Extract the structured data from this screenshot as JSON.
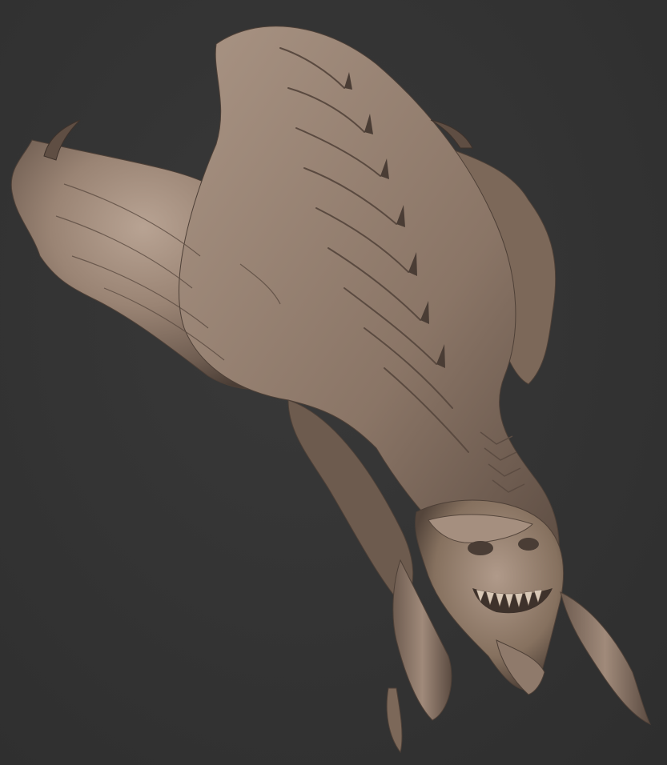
{
  "scene": {
    "subject": "creature-head-sculpt",
    "colors": {
      "background": "#323232",
      "clay_base": "#8f7a6b",
      "clay_light": "#b8a393",
      "clay_shadow": "#5a4a40",
      "clay_dark": "#3e322b",
      "tooth": "#d8c8b6"
    }
  }
}
